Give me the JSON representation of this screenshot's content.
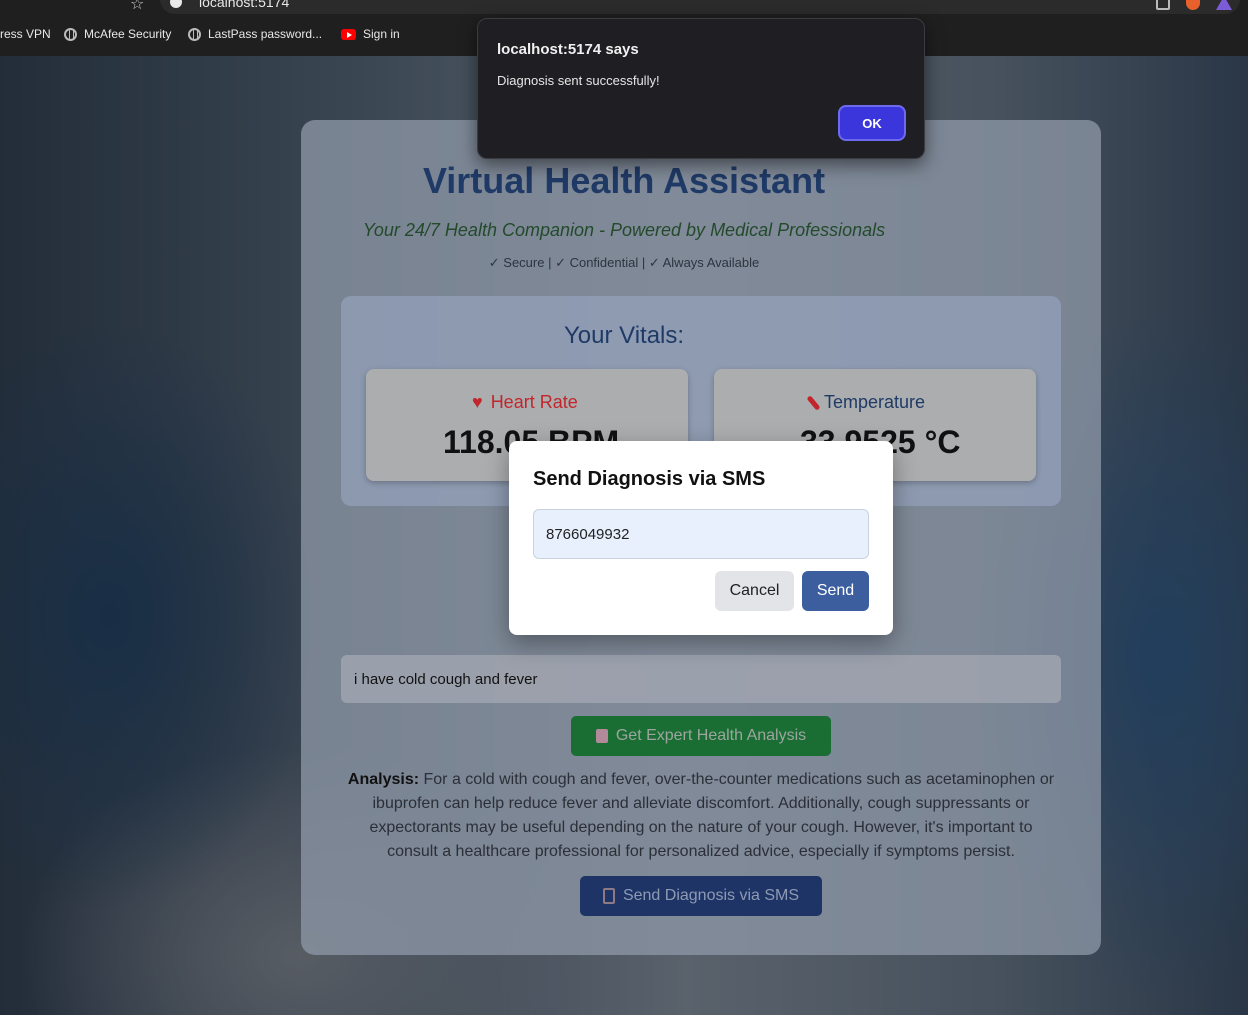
{
  "browser": {
    "url": "localhost:5174",
    "bookmarks": [
      {
        "label": "ress VPN",
        "icon": "none"
      },
      {
        "label": "McAfee Security",
        "icon": "globe-icon"
      },
      {
        "label": "LastPass password...",
        "icon": "globe-icon"
      },
      {
        "label": "Sign in",
        "icon": "youtube-icon"
      }
    ]
  },
  "alert": {
    "title": "localhost:5174 says",
    "message": "Diagnosis sent successfully!",
    "ok_label": "OK"
  },
  "app": {
    "title": "Virtual Health Assistant",
    "tagline": "Your 24/7 Health Companion - Powered by Medical Professionals",
    "badges": "✓ Secure | ✓ Confidential | ✓ Always Available",
    "vitals_title": "Your Vitals:",
    "vitals": [
      {
        "label": "Heart Rate",
        "icon": "heart-icon",
        "value": "118.05 BPM"
      },
      {
        "label": "Temperature",
        "icon": "thermometer-icon",
        "value": "33.9525 °C"
      }
    ],
    "symptom_input": "i have cold cough and fever",
    "analysis_button": "Get Expert Health Analysis",
    "analysis_label": "Analysis:",
    "analysis_text": "For a cold with cough and fever, over-the-counter medications such as acetaminophen or ibuprofen can help reduce fever and alleviate discomfort. Additionally, cough suppressants or expectorants may be useful depending on the nature of your cough. However, it's important to consult a healthcare professional for personalized advice, especially if symptoms persist.",
    "sms_button": "Send Diagnosis via SMS"
  },
  "modal": {
    "title": "Send Diagnosis via SMS",
    "phone": "8766049932",
    "cancel_label": "Cancel",
    "send_label": "Send"
  },
  "colors": {
    "title": "#1f3a66",
    "tagline": "#234a2b",
    "heart": "#c0262c",
    "analysis_button": "#1a6e34",
    "sms_button": "#1e3466",
    "send_button": "#3d5e9e",
    "ok_button": "#3b35dc"
  }
}
